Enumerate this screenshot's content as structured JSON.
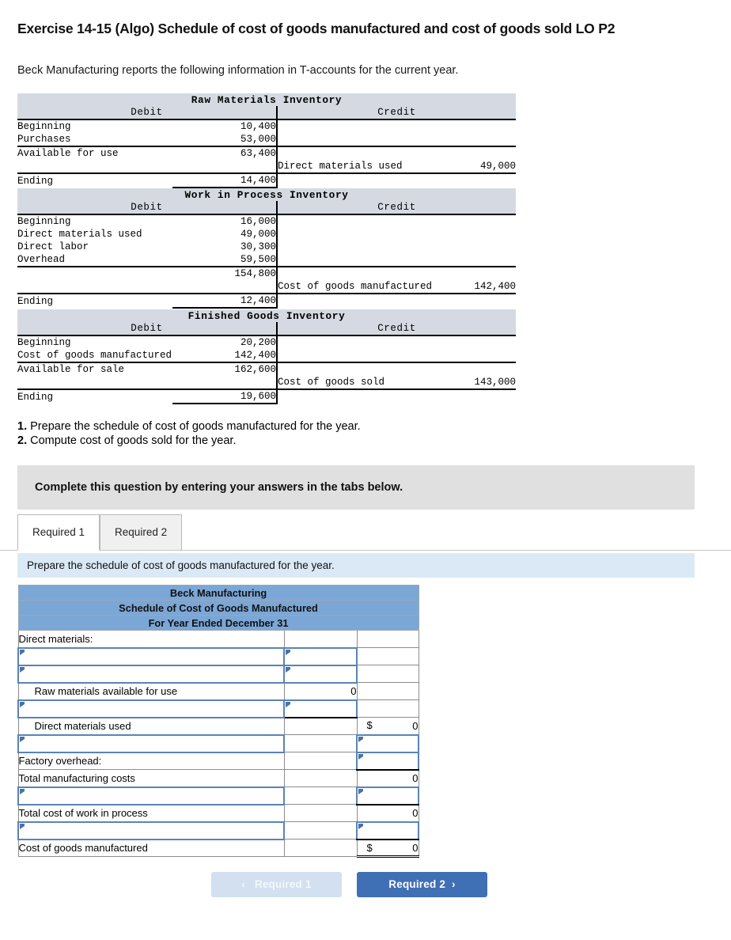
{
  "page": {
    "title": "Exercise 14-15 (Algo) Schedule of cost of goods manufactured and cost of goods sold LO P2",
    "intro": "Beck Manufacturing reports the following information in T-accounts for the current year."
  },
  "taccounts": [
    {
      "name": "raw-materials-inventory",
      "title": "Raw Materials Inventory",
      "debit_header": "Debit",
      "credit_header": "Credit",
      "debit_rows": [
        {
          "label": "Beginning",
          "amount": "10,400"
        },
        {
          "label": "Purchases",
          "amount": "53,000"
        }
      ],
      "subtotal": {
        "label": "Available for use",
        "amount": "63,400"
      },
      "credit_rows": [
        {
          "label": "Direct materials used",
          "amount": "49,000"
        }
      ],
      "ending": {
        "label": "Ending",
        "amount": "14,400"
      }
    },
    {
      "name": "work-in-process-inventory",
      "title": "Work in Process Inventory",
      "debit_header": "Debit",
      "credit_header": "Credit",
      "debit_rows": [
        {
          "label": "Beginning",
          "amount": "16,000"
        },
        {
          "label": "Direct materials used",
          "amount": "49,000"
        },
        {
          "label": "Direct labor",
          "amount": "30,300"
        },
        {
          "label": "Overhead",
          "amount": "59,500"
        }
      ],
      "subtotal": {
        "label": "",
        "amount": "154,800"
      },
      "credit_rows": [
        {
          "label": "Cost of goods manufactured",
          "amount": "142,400"
        }
      ],
      "ending": {
        "label": "Ending",
        "amount": "12,400"
      }
    },
    {
      "name": "finished-goods-inventory",
      "title": "Finished Goods Inventory",
      "debit_header": "Debit",
      "credit_header": "Credit",
      "debit_rows": [
        {
          "label": "Beginning",
          "amount": "20,200"
        },
        {
          "label": "Cost of goods manufactured",
          "amount": "142,400"
        }
      ],
      "subtotal": {
        "label": "Available for sale",
        "amount": "162,600"
      },
      "credit_rows": [
        {
          "label": "Cost of goods sold",
          "amount": "143,000"
        }
      ],
      "ending": {
        "label": "Ending",
        "amount": "19,600"
      }
    }
  ],
  "requirements": [
    {
      "num": "1.",
      "text": "Prepare the schedule of cost of goods manufactured for the year."
    },
    {
      "num": "2.",
      "text": "Compute cost of goods sold for the year."
    }
  ],
  "banner": {
    "text": "Complete this question by entering your answers in the tabs below."
  },
  "tabs": [
    {
      "label": "Required 1",
      "active": true
    },
    {
      "label": "Required 2",
      "active": false
    }
  ],
  "instruction_bar": {
    "text": "Prepare the schedule of cost of goods manufactured for the year."
  },
  "schedule": {
    "headers": [
      "Beck Manufacturing",
      "Schedule of Cost of Goods Manufactured",
      "For Year Ended December 31"
    ],
    "rows": [
      {
        "label": "Direct materials:",
        "indent": false,
        "label_type": "text",
        "col2": "",
        "col2_type": "empty",
        "col3": "",
        "col3_type": "empty"
      },
      {
        "label": "",
        "indent": false,
        "label_type": "input",
        "col2": "",
        "col2_type": "input",
        "col3": "",
        "col3_type": "empty"
      },
      {
        "label": "",
        "indent": false,
        "label_type": "input",
        "col2": "",
        "col2_type": "input",
        "col3": "",
        "col3_type": "empty"
      },
      {
        "label": "Raw materials available for use",
        "indent": true,
        "label_type": "text",
        "col2": "0",
        "col2_type": "num",
        "col3": "",
        "col3_type": "empty"
      },
      {
        "label": "",
        "indent": false,
        "label_type": "input",
        "col2": "",
        "col2_type": "input-underline",
        "col3": "",
        "col3_type": "empty"
      },
      {
        "label": "Direct materials used",
        "indent": true,
        "label_type": "text",
        "col2": "",
        "col2_type": "empty",
        "col3": "0",
        "col3_type": "dollar"
      },
      {
        "label": "",
        "indent": false,
        "label_type": "input",
        "col2": "",
        "col2_type": "empty",
        "col3": "",
        "col3_type": "input"
      },
      {
        "label": "Factory overhead:",
        "indent": false,
        "label_type": "text",
        "col2": "",
        "col2_type": "empty",
        "col3": "",
        "col3_type": "input-underline"
      },
      {
        "label": "Total manufacturing costs",
        "indent": false,
        "label_type": "text",
        "col2": "",
        "col2_type": "empty",
        "col3": "0",
        "col3_type": "num"
      },
      {
        "label": "",
        "indent": false,
        "label_type": "input",
        "col2": "",
        "col2_type": "empty",
        "col3": "",
        "col3_type": "input-underline"
      },
      {
        "label": "Total cost of work in process",
        "indent": false,
        "label_type": "text",
        "col2": "",
        "col2_type": "empty",
        "col3": "0",
        "col3_type": "num"
      },
      {
        "label": "",
        "indent": false,
        "label_type": "input",
        "col2": "",
        "col2_type": "empty",
        "col3": "",
        "col3_type": "input-underline"
      },
      {
        "label": "Cost of goods manufactured",
        "indent": false,
        "label_type": "text",
        "col2": "",
        "col2_type": "empty",
        "col3": "0",
        "col3_type": "dollar-total"
      }
    ],
    "dollar_sign": "$"
  },
  "nav": {
    "prev_label": "Required 1",
    "next_label": "Required 2",
    "prev_chevron": "‹",
    "next_chevron": "›"
  },
  "colors": {
    "schedule_header_blue": "#7ba7d7",
    "taccount_header": "#d5dae2",
    "instruction_bar_blue": "#dbe9f7",
    "banner_grey": "#e0e0e0",
    "input_border": "#5b83b5",
    "next_button": "#3f6fb5",
    "prev_button": "#d2e0f0"
  }
}
